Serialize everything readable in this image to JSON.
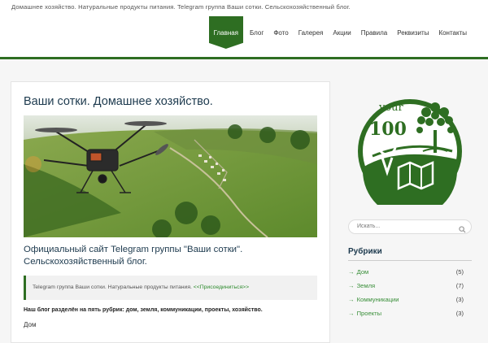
{
  "header": {
    "tagline": "Домашнее хозяйство. Натуральные продукты питания. Telegram группа Ваши сотки. Сельскохозяйственный блог."
  },
  "nav": {
    "items": [
      {
        "label": "Главная",
        "active": true
      },
      {
        "label": "Блог"
      },
      {
        "label": "Фото"
      },
      {
        "label": "Галерея"
      },
      {
        "label": "Акции"
      },
      {
        "label": "Правила"
      },
      {
        "label": "Реквизиты"
      },
      {
        "label": "Контакты"
      }
    ]
  },
  "post": {
    "title": "Ваши сотки. Домашнее хозяйство.",
    "subtitle": "Официальный сайт Telegram группы \"Ваши сотки\". Сельскохозяйственный блог.",
    "quote_text": "Telegram группа Ваши сотки. Натуральные продукты питания.",
    "quote_link": "<<Присоединиться>>",
    "rubrics_text": "Наш блог разделён на пять рубрик: дом, земля, коммуникации, проекты, хозяйство.",
    "next_heading": "Дом"
  },
  "logo": {
    "word": "your",
    "number": "100"
  },
  "search": {
    "placeholder": "Искать..."
  },
  "sidebar": {
    "title": "Рубрики",
    "categories": [
      {
        "label": "Дом",
        "count": "(5)"
      },
      {
        "label": "Земля",
        "count": "(7)"
      },
      {
        "label": "Коммуникации",
        "count": "(3)"
      },
      {
        "label": "Проекты",
        "count": "(3)"
      }
    ]
  },
  "colors": {
    "brand_green": "#2e6e22",
    "link_green": "#3a8f3a"
  }
}
